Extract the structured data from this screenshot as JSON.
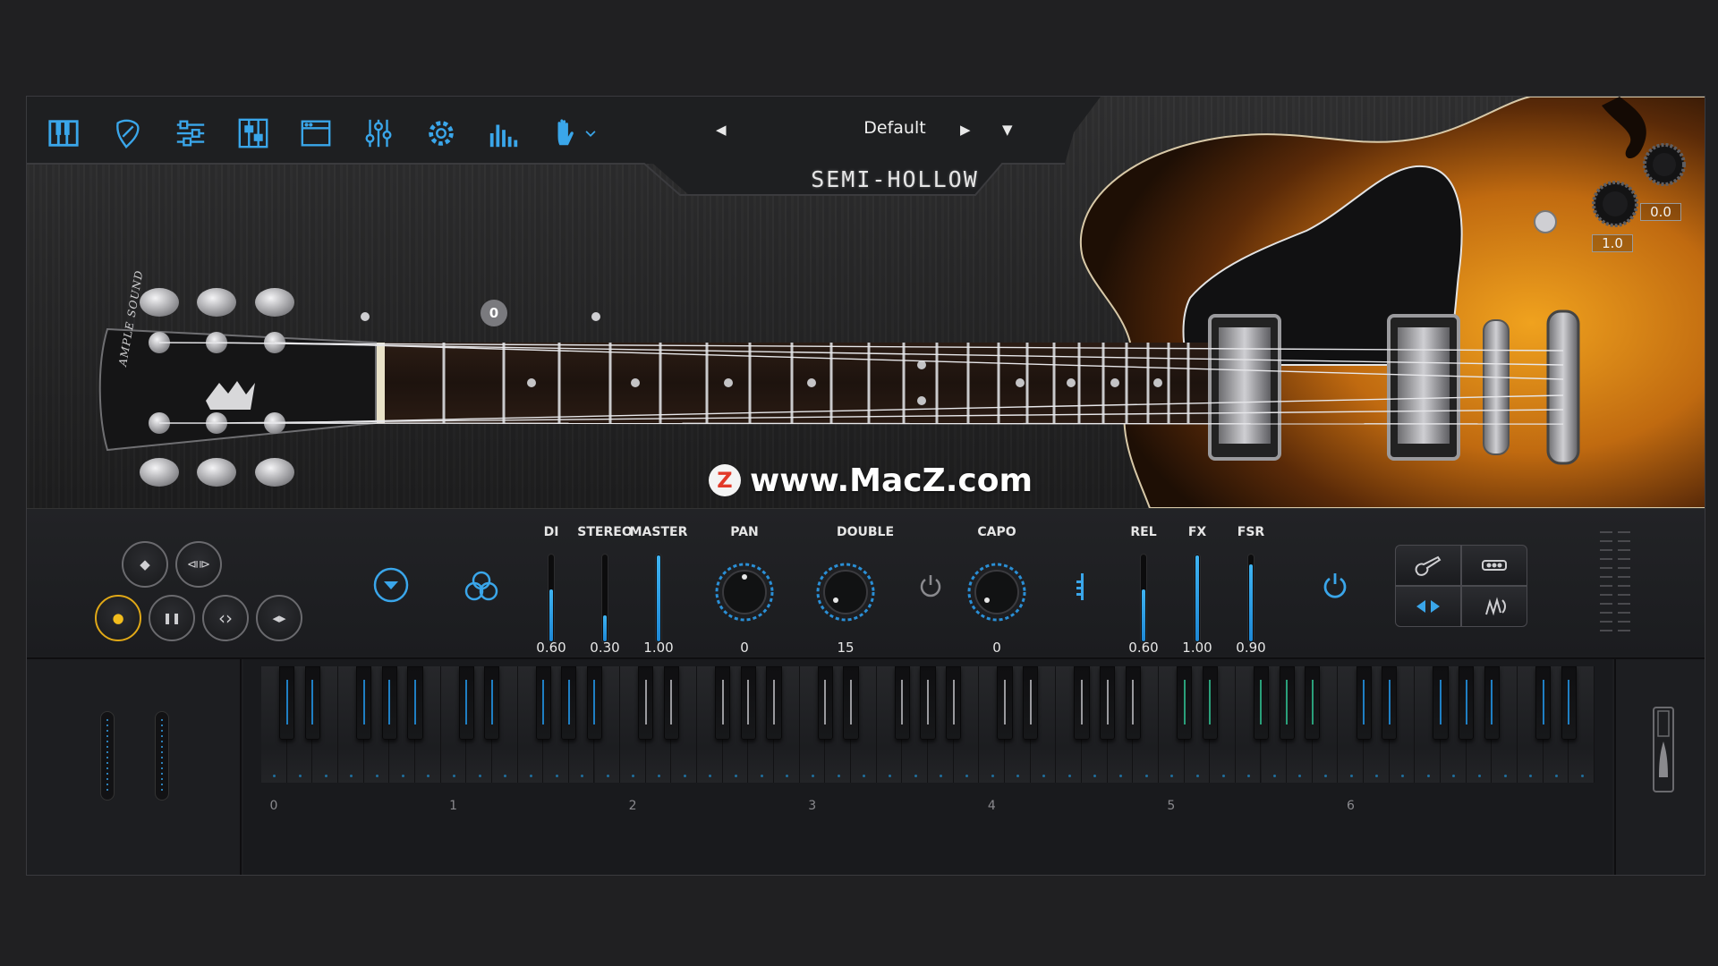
{
  "toolbar": {
    "icons": [
      "piano-keys-icon",
      "pick-icon",
      "sliders-horizontal-icon",
      "mixer-panel-icon",
      "window-icon",
      "eq-sliders-icon",
      "gear-icon",
      "bar-graph-icon",
      "hand-icon"
    ],
    "accent": "#3aa6ea"
  },
  "preset": {
    "name": "Default",
    "prev": "◀",
    "next": "▶",
    "menu": "▼"
  },
  "product": {
    "title": "SEMI-HOLLOW"
  },
  "watermark": {
    "logo_letter": "Z",
    "text": "www.MacZ.com"
  },
  "headstock": {
    "brand": "AMPLE SOUND"
  },
  "fret_marker": "0",
  "guitar_controls": {
    "knob_value_left": "1.0",
    "knob_value_right": "0.0"
  },
  "transport": {
    "record": "●",
    "stop": "◆",
    "pause": "❚❚",
    "loop": "⧏⧐",
    "in_out": "‹›",
    "rewind": "◂▸"
  },
  "panel": {
    "di": {
      "label": "DI",
      "value": "0.60",
      "level": 0.6
    },
    "stereo": {
      "label": "STEREO",
      "value": "0.30",
      "level": 0.3
    },
    "master": {
      "label": "MASTER",
      "value": "1.00",
      "level": 1.0
    },
    "pan": {
      "label": "PAN",
      "value": "0"
    },
    "double": {
      "label": "DOUBLE",
      "value": "15"
    },
    "capo": {
      "label": "CAPO",
      "value": "0"
    },
    "rel": {
      "label": "REL",
      "value": "0.60",
      "level": 0.6
    },
    "fx": {
      "label": "FX",
      "value": "1.00",
      "level": 1.0
    },
    "fsr": {
      "label": "FSR",
      "value": "0.90",
      "level": 0.9
    }
  },
  "keyboard": {
    "octaves": [
      "0",
      "1",
      "2",
      "3",
      "4",
      "5",
      "6"
    ]
  },
  "colors": {
    "accent": "#3aa6ea",
    "record": "#f2bd1d",
    "panel": "#1c1d20"
  }
}
